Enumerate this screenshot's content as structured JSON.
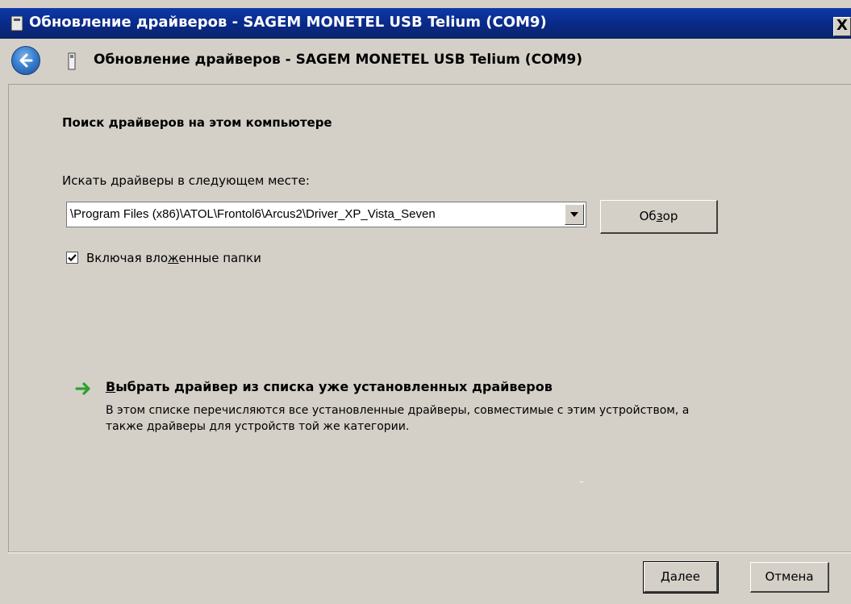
{
  "window": {
    "title": "Обновление драйверов - SAGEM MONETEL USB Telium (COM9)",
    "close_label": "X"
  },
  "header": {
    "title": "Обновление драйверов - SAGEM MONETEL USB Telium (COM9)"
  },
  "content": {
    "section_title": "Поиск драйверов на этом компьютере",
    "location_label": "Искать драйверы в следующем месте:",
    "path_value": "\\Program Files (x86)\\ATOL\\Frontol6\\Arcus2\\Driver_XP_Vista_Seven",
    "browse_button": {
      "pre": "Об",
      "accel": "з",
      "post": "ор"
    },
    "include_subfolders": {
      "checked": true,
      "pre": "Включая вло",
      "accel": "ж",
      "post": "енные папки"
    },
    "pick_link": {
      "pre": "",
      "accel": "В",
      "post": "ыбрать драйвер из списка уже установленных драйверов",
      "description": "В этом списке перечисляются все установленные драйверы, совместимые с этим устройством, а также драйверы для устройств той же категории."
    }
  },
  "footer": {
    "next_button": {
      "pre": "",
      "accel": "Д",
      "post": "алее"
    },
    "cancel_button": "Отмена"
  },
  "colors": {
    "titlebar": "#0a246a",
    "face": "#d4d0c8",
    "arrow": "#2fa02f"
  }
}
